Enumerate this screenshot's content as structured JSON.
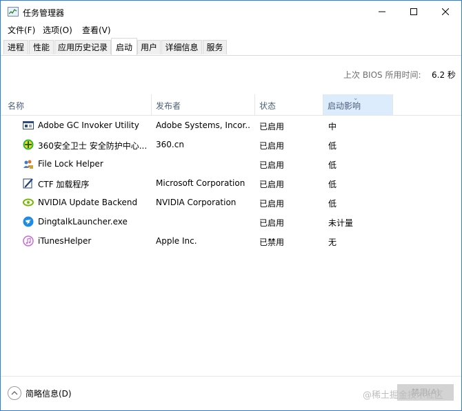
{
  "window": {
    "title": "任务管理器",
    "app_icon": "task-manager-icon",
    "minimize_icon": "minimize-icon",
    "maximize_icon": "maximize-icon",
    "close_icon": "close-icon"
  },
  "menu": [
    "文件(F)",
    "选项(O)",
    "查看(V)"
  ],
  "tabs": [
    "进程",
    "性能",
    "应用历史记录",
    "启动",
    "用户",
    "详细信息",
    "服务"
  ],
  "active_tab": "启动",
  "bios": {
    "label": "上次 BIOS 所用时间:",
    "value": "6.2 秒"
  },
  "columns": {
    "name": "名称",
    "publisher": "发布者",
    "status": "状态",
    "impact": "启动影响"
  },
  "rows": [
    {
      "icon": "adobe-gc-app-icon",
      "name": "Adobe GC Invoker Utility",
      "publisher": "Adobe Systems, Incor...",
      "status": "已启用",
      "impact": "中"
    },
    {
      "icon": "360-security-icon",
      "name": "360安全卫士 安全防护中心...",
      "publisher": "360.cn",
      "status": "已启用",
      "impact": "低"
    },
    {
      "icon": "users-lock-icon",
      "name": "File Lock Helper",
      "publisher": "",
      "status": "已启用",
      "impact": "低"
    },
    {
      "icon": "ctf-pen-icon",
      "name": "CTF 加载程序",
      "publisher": "Microsoft Corporation",
      "status": "已启用",
      "impact": "低"
    },
    {
      "icon": "nvidia-icon",
      "name": "NVIDIA Update Backend",
      "publisher": "NVIDIA Corporation",
      "status": "已启用",
      "impact": "低"
    },
    {
      "icon": "dingtalk-icon",
      "name": "DingtalkLauncher.exe",
      "publisher": "",
      "status": "已启用",
      "impact": "未计量"
    },
    {
      "icon": "itunes-icon",
      "name": "iTunesHelper",
      "publisher": "Apple Inc.",
      "status": "已禁用",
      "impact": "无"
    }
  ],
  "footer": {
    "fewer_details": "简略信息(D)",
    "fewer_icon": "chevron-up-icon",
    "watermark": "@稀土掘金技术社区",
    "disable_button": "禁用(A)"
  }
}
